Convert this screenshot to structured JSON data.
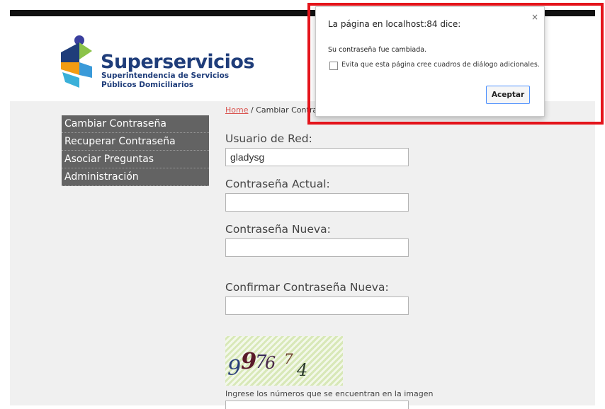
{
  "logo": {
    "title": "Superservicios",
    "subtitle_line1": "Superintendencia de Servicios",
    "subtitle_line2": "Públicos Domiciliarios"
  },
  "breadcrumb": {
    "home": "Home",
    "separator": " / ",
    "current": "Cambiar Contraseña"
  },
  "menu": {
    "items": [
      {
        "label": "Cambiar Contraseña"
      },
      {
        "label": "Recuperar Contraseña"
      },
      {
        "label": "Asociar Preguntas"
      },
      {
        "label": "Administración"
      }
    ]
  },
  "form": {
    "username_label": "Usuario de Red:",
    "username_value": "gladysg",
    "current_password_label": "Contraseña Actual:",
    "new_password_label": "Contraseña Nueva:",
    "confirm_password_label": "Confirmar Contraseña Nueva:",
    "captcha_text": "997674",
    "captcha_hint": "Ingrese los números que se encuentran en la imagen"
  },
  "dialog": {
    "title": "La página en localhost:84 dice:",
    "message": "Su contraseña fue cambiada.",
    "checkbox_label": "Evita que esta página cree cuadros de diálogo adicionales.",
    "ok_label": "Aceptar",
    "close_symbol": "×"
  },
  "colors": {
    "highlight_border": "#e4141b",
    "menu_bg": "#636363",
    "brand_blue": "#1f3d7a",
    "link": "#d9534f"
  }
}
